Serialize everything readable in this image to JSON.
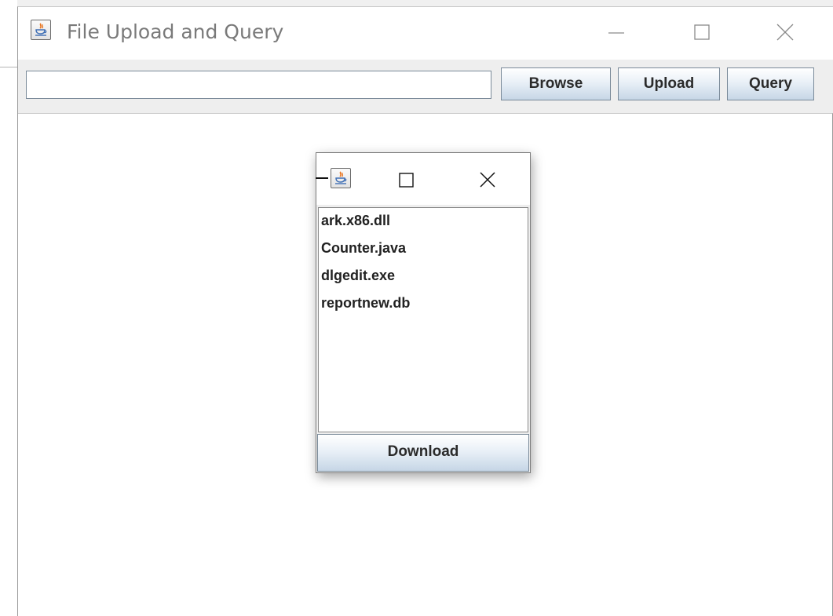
{
  "main_window": {
    "title": "File Upload and Query",
    "icon": "java-icon",
    "controls": [
      "minimize-icon",
      "maximize-icon",
      "close-icon"
    ]
  },
  "toolbar": {
    "path_value": "",
    "browse_label": "Browse",
    "upload_label": "Upload",
    "query_label": "Query"
  },
  "popup": {
    "icon": "java-icon",
    "controls": [
      "maximize-icon",
      "close-icon"
    ],
    "files": [
      "ark.x86.dll",
      "Counter.java",
      "dlgedit.exe",
      "reportnew.db"
    ],
    "download_label": "Download"
  },
  "colors": {
    "button_gradient_top": "#ffffff",
    "button_gradient_bottom": "#c6d6e6",
    "button_border": "#7a8a99",
    "title_text": "#7a7a7a",
    "toolbar_bg": "#eeeeee"
  }
}
